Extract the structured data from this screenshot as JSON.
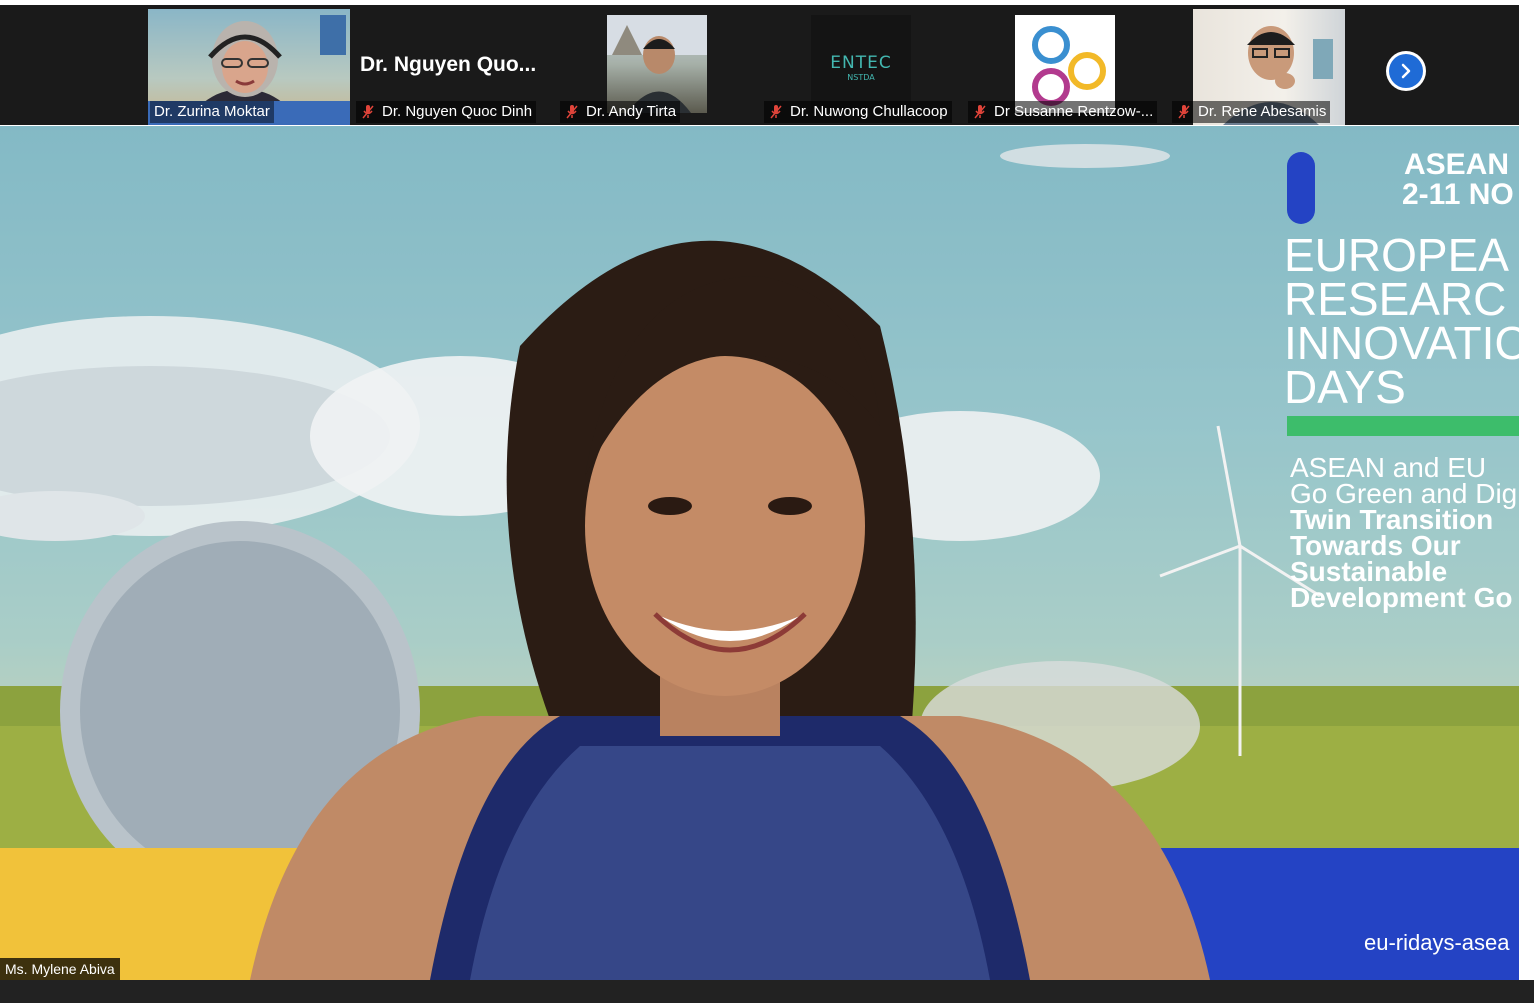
{
  "top_strip": {
    "participants": [
      {
        "name": "Dr. Zurina Moktar",
        "muted": false,
        "has_video": true
      },
      {
        "name": "Dr. Nguyen Quoc Dinh",
        "display_title": "Dr. Nguyen Quo...",
        "muted": true,
        "has_video": false
      },
      {
        "name": "Dr. Andy Tirta",
        "muted": true,
        "has_video": true
      },
      {
        "name": "Dr. Nuwong Chullacoop",
        "muted": true,
        "has_video": true,
        "logo_text": "ENTEC",
        "logo_subtext": "NSTDA"
      },
      {
        "name": "Dr Susanne Rentzow-...",
        "muted": true,
        "has_video": true
      },
      {
        "name": "Dr. Rene Abesamis",
        "muted": true,
        "has_video": true
      }
    ],
    "next_icon": "chevron-right-icon"
  },
  "main": {
    "speaker_name": "Ms. Mylene Abiva",
    "banner": {
      "line1": "ASEAN",
      "line2": "2-11 NO",
      "title_lines": [
        "EUROPEA",
        "RESEARC",
        "INNOVATIC",
        "DAYS"
      ],
      "subtitle_lines": [
        "ASEAN and EU",
        "Go Green and Dig"
      ],
      "bold_lines": [
        "Twin Transition",
        "Towards Our",
        "Sustainable",
        "Development Go"
      ],
      "url": "eu-ridays-asea"
    }
  },
  "colors": {
    "strip_bg": "#1a1a1a",
    "accent_blue": "#1f6bd6",
    "banner_blue": "#2443c4",
    "banner_yellow": "#f1c23a",
    "banner_green": "#3dbd6b"
  }
}
